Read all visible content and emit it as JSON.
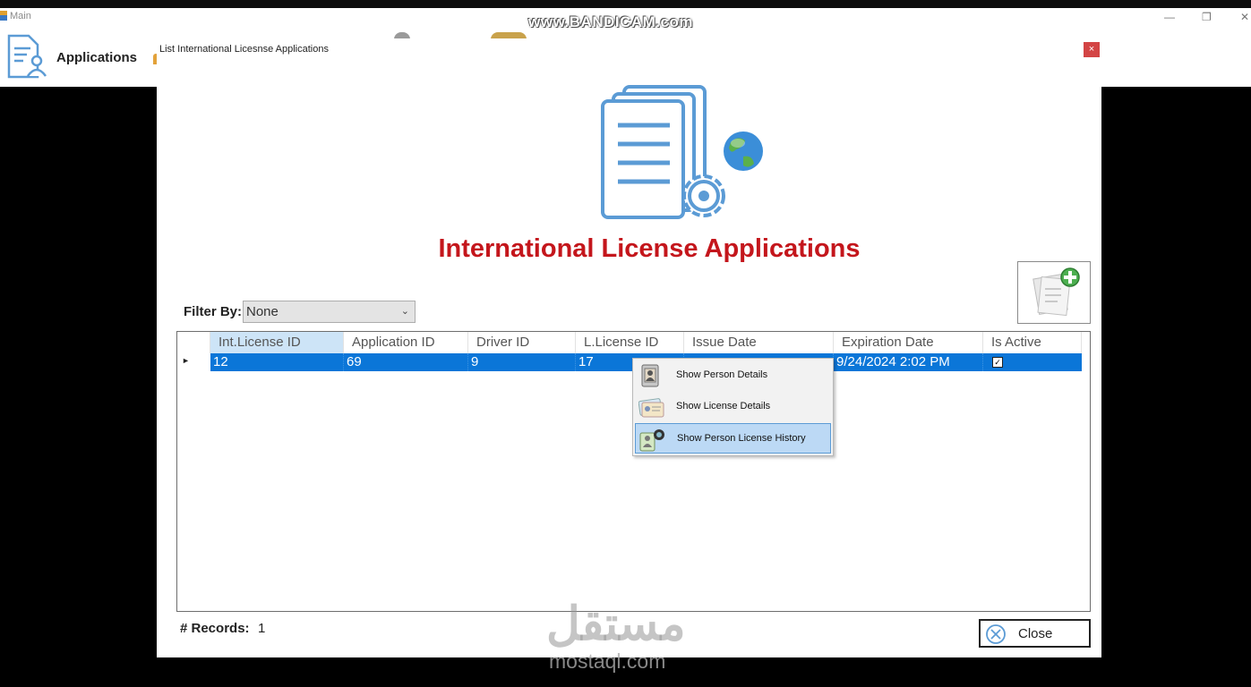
{
  "main_window": {
    "title": "Main",
    "applications_label": "Applications",
    "controls": [
      "—",
      "❐",
      "✕"
    ]
  },
  "recorder_watermark": "www.BANDICAM.com",
  "dialog": {
    "title": "List International Licesnse Applications",
    "close_glyph": "×",
    "page_title": "International License Applications",
    "filter": {
      "label": "Filter By:",
      "selected": "None"
    },
    "grid": {
      "columns": [
        "Int.License ID",
        "Application ID",
        "Driver ID",
        "L.License ID",
        "Issue Date",
        "Expiration Date",
        "Is Active"
      ],
      "rows": [
        {
          "int_license_id": "12",
          "application_id": "69",
          "driver_id": "9",
          "l_license_id": "17",
          "issue_date": "",
          "expiration_date": "9/24/2024 2:02 PM",
          "is_active": true
        }
      ]
    },
    "context_menu": {
      "items": [
        {
          "label": "Show Person Details",
          "icon": "person-card-icon"
        },
        {
          "label": "Show License Details",
          "icon": "license-card-icon"
        },
        {
          "label": "Show Person License History",
          "icon": "person-history-icon"
        }
      ],
      "hovered_index": 2
    },
    "records": {
      "label": "# Records:",
      "count": "1"
    },
    "close_button": {
      "label": "Close"
    }
  },
  "site_watermark": {
    "arabic": "مستقل",
    "latin": "mostaql.com"
  },
  "colors": {
    "title_red": "#c4161c",
    "row_selected": "#0b76d8",
    "menu_hover": "#bcd9f5",
    "icon_blue": "#5b9bd5"
  }
}
